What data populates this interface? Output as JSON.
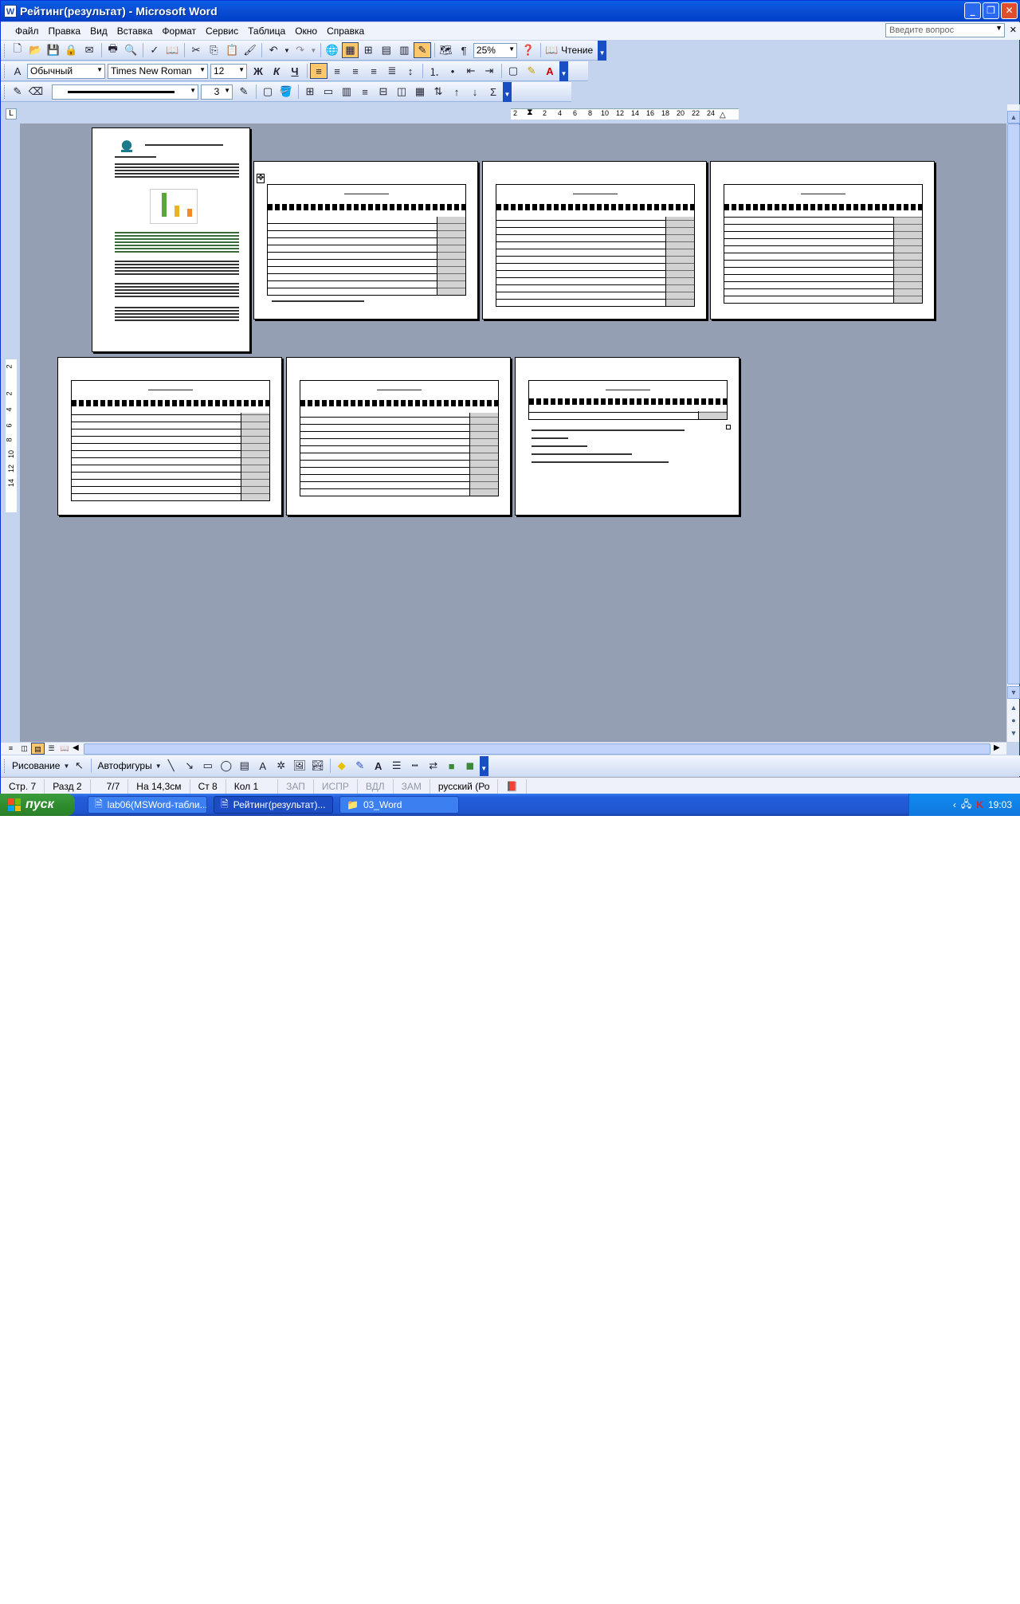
{
  "window": {
    "title": "Рейтинг(результат) - Microsoft Word",
    "app_icon_letter": "W"
  },
  "menu": {
    "items": [
      "Файл",
      "Правка",
      "Вид",
      "Вставка",
      "Формат",
      "Сервис",
      "Таблица",
      "Окно",
      "Справка"
    ],
    "ask_placeholder": "Введите вопрос"
  },
  "toolbar_standard": {
    "zoom": "25%",
    "reading_label": "Чтение"
  },
  "toolbar_formatting": {
    "style": "Обычный",
    "font": "Times New Roman",
    "size": "12",
    "bold": "Ж",
    "italic": "К",
    "underline": "Ч"
  },
  "toolbar_tables": {
    "line_weight": "3",
    "sum": "Σ"
  },
  "ruler": {
    "numbers": [
      "2",
      "2",
      "4",
      "6",
      "8",
      "10",
      "12",
      "14",
      "16",
      "18",
      "20",
      "22",
      "24"
    ],
    "vnumbers": [
      "2",
      "2",
      "4",
      "6",
      "8",
      "10",
      "12",
      "14"
    ]
  },
  "drawing_bar": {
    "draw_label": "Рисование",
    "autoshapes_label": "Автофигуры"
  },
  "status": {
    "page": "Стр. 7",
    "section": "Разд 2",
    "pages": "7/7",
    "at": "На 14,3см",
    "line": "Ст 8",
    "col": "Кол 1",
    "rec": "ЗАП",
    "trk": "ИСПР",
    "ext": "ВДЛ",
    "ovr": "ЗАМ",
    "lang": "русский (Ро"
  },
  "taskbar": {
    "start": "пуск",
    "tasks": [
      "lab06(MSWord-табли...",
      "Рейтинг(результат)...",
      "03_Word"
    ],
    "lang": "RU",
    "clock": "19:03"
  },
  "colors": {
    "workspace": "#959fb4",
    "titlebar": "#0b4fd5",
    "taskbar": "#245edb",
    "start": "#2f8d2f"
  }
}
